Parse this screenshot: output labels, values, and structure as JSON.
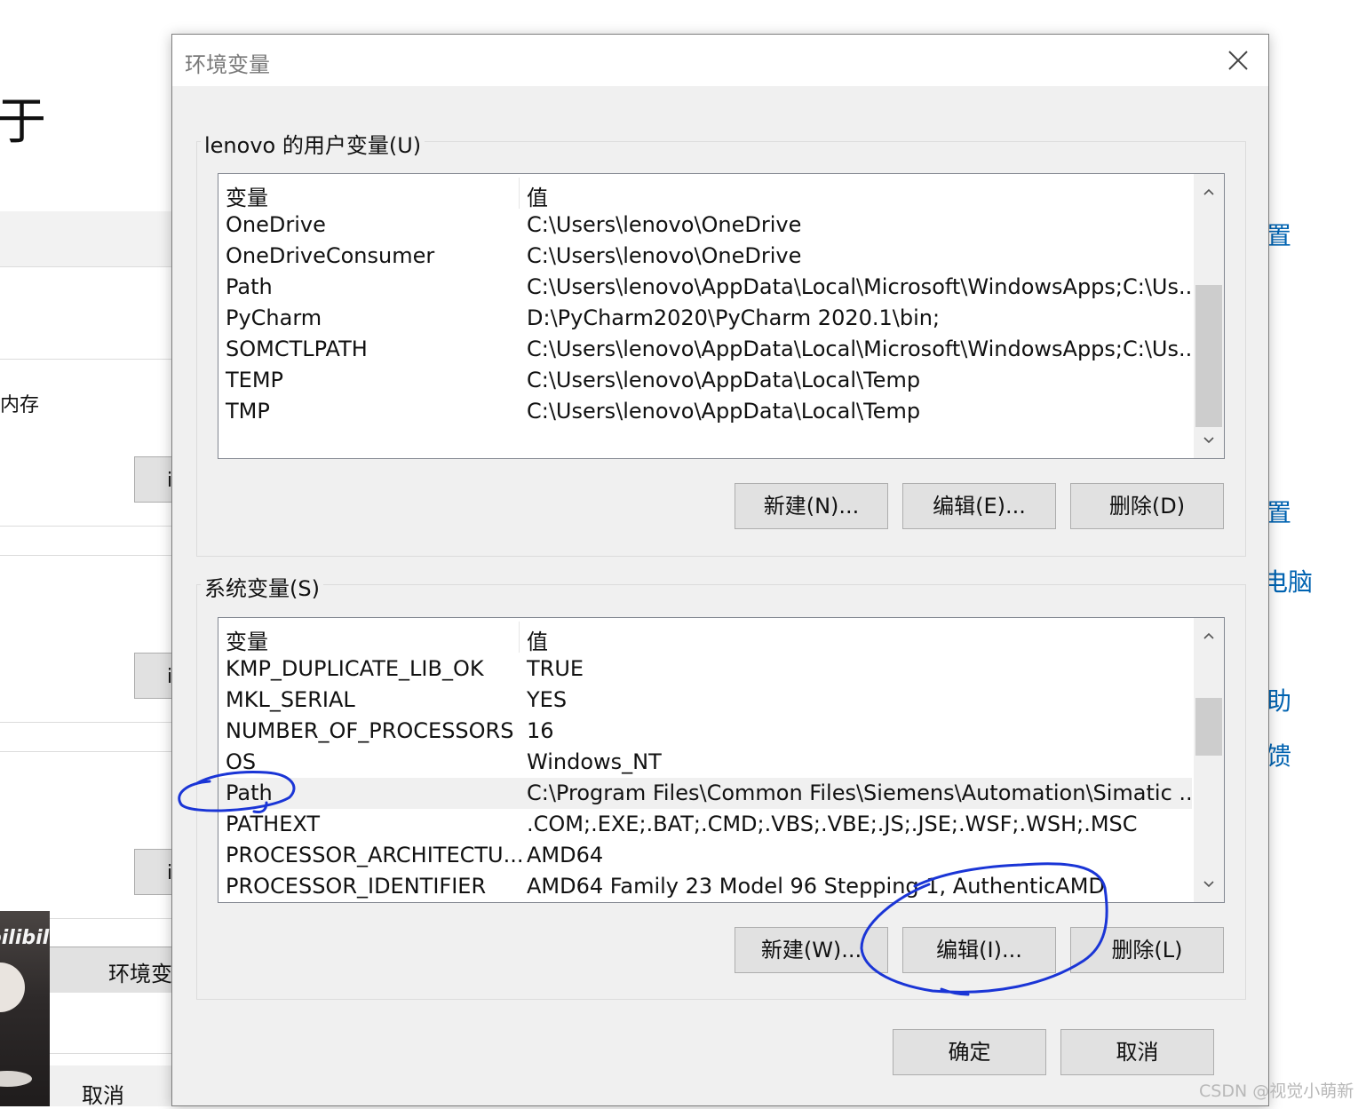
{
  "background": {
    "title_fragment": "于",
    "memory_fragment": "内存",
    "button_fragment": "i",
    "env_button_fragment": "环境变",
    "cancel_label": "取消",
    "bilibili_logo": "bilibili",
    "right_links": [
      "置",
      "置",
      "电脑",
      "助",
      "馈"
    ]
  },
  "dialog": {
    "title": "环境变量",
    "close_icon": "close-icon",
    "user_group": {
      "label": "lenovo 的用户变量(U)",
      "header": {
        "name": "变量",
        "value": "值"
      },
      "rows": [
        {
          "name": "OneDrive",
          "value": "C:\\Users\\lenovo\\OneDrive"
        },
        {
          "name": "OneDriveConsumer",
          "value": "C:\\Users\\lenovo\\OneDrive"
        },
        {
          "name": "Path",
          "value": "C:\\Users\\lenovo\\AppData\\Local\\Microsoft\\WindowsApps;C:\\Us..."
        },
        {
          "name": "PyCharm",
          "value": "D:\\PyCharm2020\\PyCharm 2020.1\\bin;"
        },
        {
          "name": "SOMCTLPATH",
          "value": "C:\\Users\\lenovo\\AppData\\Local\\Microsoft\\WindowsApps;C:\\Us..."
        },
        {
          "name": "TEMP",
          "value": "C:\\Users\\lenovo\\AppData\\Local\\Temp"
        },
        {
          "name": "TMP",
          "value": "C:\\Users\\lenovo\\AppData\\Local\\Temp"
        }
      ],
      "buttons": {
        "new": "新建(N)...",
        "edit": "编辑(E)...",
        "delete": "删除(D)"
      }
    },
    "system_group": {
      "label": "系统变量(S)",
      "header": {
        "name": "变量",
        "value": "值"
      },
      "rows": [
        {
          "name": "KMP_DUPLICATE_LIB_OK",
          "value": "TRUE"
        },
        {
          "name": "MKL_SERIAL",
          "value": "YES"
        },
        {
          "name": "NUMBER_OF_PROCESSORS",
          "value": "16"
        },
        {
          "name": "OS",
          "value": "Windows_NT"
        },
        {
          "name": "Path",
          "value": "C:\\Program Files\\Common Files\\Siemens\\Automation\\Simatic ..."
        },
        {
          "name": "PATHEXT",
          "value": ".COM;.EXE;.BAT;.CMD;.VBS;.VBE;.JS;.JSE;.WSF;.WSH;.MSC"
        },
        {
          "name": "PROCESSOR_ARCHITECTU...",
          "value": "AMD64"
        },
        {
          "name": "PROCESSOR_IDENTIFIER",
          "value": "AMD64 Family 23 Model 96 Stepping 1, AuthenticAMD"
        }
      ],
      "selected_row": "Path",
      "buttons": {
        "new": "新建(W)...",
        "edit": "编辑(I)...",
        "delete": "删除(L)"
      }
    },
    "ok_label": "确定",
    "cancel_label": "取消"
  },
  "annotation_color": "#1a35d6",
  "watermark": "CSDN @视觉小萌新"
}
